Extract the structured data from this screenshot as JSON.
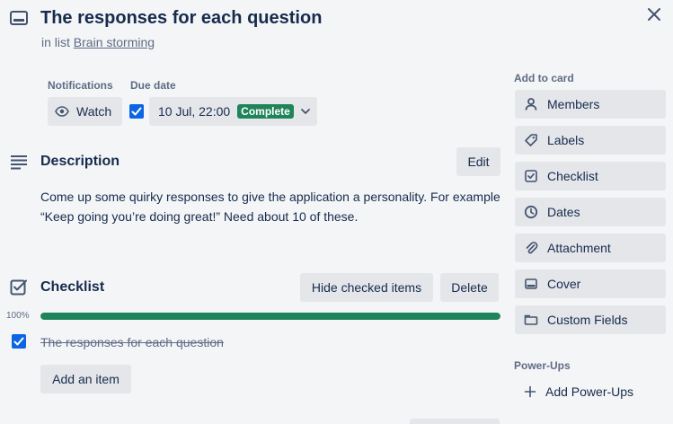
{
  "card": {
    "title": "The responses for each question",
    "in_list_prefix": "in list",
    "list_name": "Brain storming"
  },
  "notifications": {
    "label": "Notifications",
    "watch_label": "Watch"
  },
  "due_date": {
    "label": "Due date",
    "value": "10 Jul, 22:00",
    "status": "Complete",
    "checked": true
  },
  "description": {
    "title": "Description",
    "edit_label": "Edit",
    "text": "Come up some quirky responses to give the application a personality. For example “Keep going you’re doing great!” Need about 10 of these."
  },
  "checklist": {
    "title": "Checklist",
    "hide_label": "Hide checked items",
    "delete_label": "Delete",
    "progress_text": "100%",
    "progress": 1.0,
    "items": [
      {
        "text": "The responses for each question",
        "checked": true
      }
    ],
    "add_item_label": "Add an item"
  },
  "sidebar": {
    "add_to_card_label": "Add to card",
    "buttons": [
      {
        "label": "Members",
        "icon": "person-icon"
      },
      {
        "label": "Labels",
        "icon": "tag-icon"
      },
      {
        "label": "Checklist",
        "icon": "checkbox-icon"
      },
      {
        "label": "Dates",
        "icon": "clock-icon"
      },
      {
        "label": "Attachment",
        "icon": "paperclip-icon"
      },
      {
        "label": "Cover",
        "icon": "card-cover-icon"
      },
      {
        "label": "Custom Fields",
        "icon": "custom-fields-icon"
      }
    ],
    "powerups_label": "Power-Ups",
    "add_powerups_label": "Add Power-Ups"
  },
  "colors": {
    "accent_blue": "#0c66e4",
    "complete_green": "#1f845a",
    "button_bg": "#e4e6ea",
    "background": "#f4f5f7"
  }
}
